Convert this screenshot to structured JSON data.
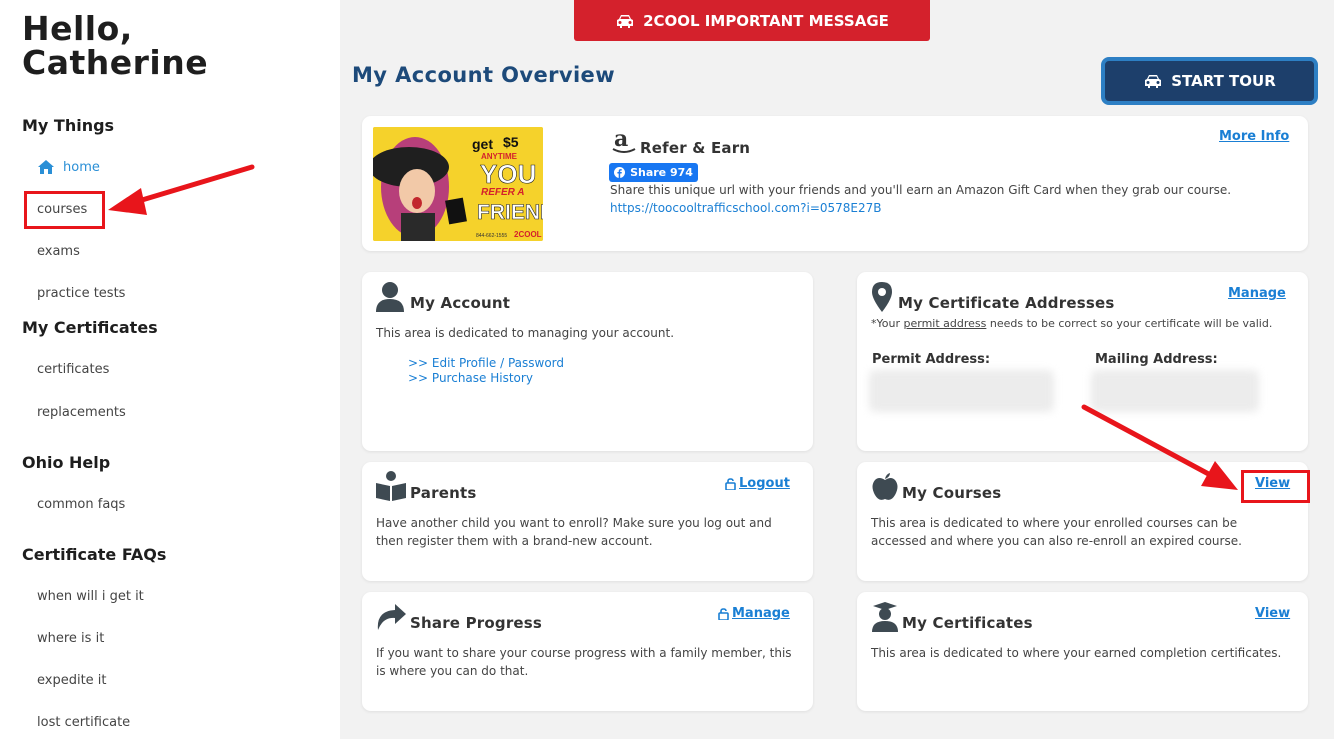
{
  "sidebar": {
    "greeting": "Hello,\nCatherine",
    "sections": [
      {
        "heading": "My Things",
        "items": [
          "home",
          "courses",
          "exams",
          "practice tests"
        ]
      },
      {
        "heading": "My Certificates",
        "items": [
          "certificates",
          "replacements"
        ]
      },
      {
        "heading": "Ohio Help",
        "items": [
          "common faqs"
        ]
      },
      {
        "heading": "Certificate FAQs",
        "items": [
          "when will i get it",
          "where is it",
          "expedite it",
          "lost certificate"
        ]
      }
    ]
  },
  "header": {
    "important_label": "2COOL IMPORTANT MESSAGE",
    "page_title": "My Account Overview",
    "tour_label": "START TOUR"
  },
  "refer": {
    "title": "Refer & Earn",
    "more_info": "More Info",
    "share_label": "Share 974",
    "text": "Share this unique url with your friends and you'll earn an Amazon Gift Card when they grab our course.",
    "url": "https://toocooltrafficschool.com?i=0578E27B",
    "image_text": {
      "get": "get",
      "amount": "$5",
      "anytime": "ANYTIME",
      "you": "YOU",
      "refer": "REFER A",
      "friend": "FRIEND",
      "phone": "844-662-1555",
      "brand": "2COOL"
    }
  },
  "account": {
    "title": "My Account",
    "text": "This area is dedicated to managing your account.",
    "links": [
      ">> Edit Profile / Password",
      ">> Purchase History"
    ]
  },
  "addresses": {
    "title": "My Certificate Addresses",
    "manage": "Manage",
    "note_prefix": "*Your ",
    "note_link": "permit address",
    "note_suffix": " needs to be correct so your certificate will be valid.",
    "permit_label": "Permit Address:",
    "mailing_label": "Mailing Address:"
  },
  "parents": {
    "title": "Parents",
    "logout": "Logout",
    "text": "Have another child you want to enroll? Make sure you log out and then register them with a brand-new account."
  },
  "courses": {
    "title": "My Courses",
    "view": "View",
    "text": "This area is dedicated to where your enrolled courses can be accessed and where you can also re-enroll an expired course."
  },
  "share": {
    "title": "Share Progress",
    "manage": "Manage",
    "text": "If you want to share your course progress with a family member, this is where you can do that."
  },
  "certificates": {
    "title": "My Certificates",
    "view": "View",
    "text": "This area is dedicated to where your earned completion certificates."
  },
  "colors": {
    "accent_red": "#d4212c",
    "title_blue": "#1d4a7a",
    "link_blue": "#1a7fd4",
    "annotation_red": "#e8151b"
  }
}
